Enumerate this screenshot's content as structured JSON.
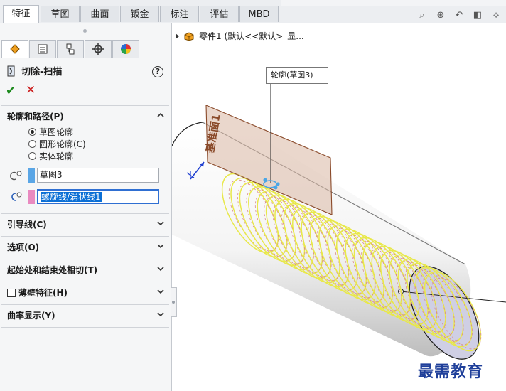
{
  "tabs": [
    "特征",
    "草图",
    "曲面",
    "钣金",
    "标注",
    "评估",
    "MBD"
  ],
  "panel": {
    "feature_title": "切除-扫描",
    "help": "?",
    "ok": "✔",
    "cancel": "✕",
    "sections": {
      "profile_path": "轮廓和路径(P)",
      "guide_curves": "引导线(C)",
      "options": "选项(O)",
      "start_end_tangency": "起始处和结束处相切(T)",
      "thin_feature": "薄壁特征(H)",
      "curvature_display": "曲率显示(Y)"
    },
    "radios": [
      {
        "label": "草图轮廓",
        "selected": true
      },
      {
        "label": "圆形轮廓(C)",
        "selected": false
      },
      {
        "label": "实体轮廓",
        "selected": false
      }
    ],
    "profile_selection": "草图3",
    "path_selection": "螺旋线/涡状线1",
    "profile_color": "#5aa6e6",
    "path_color": "#e98ac0"
  },
  "viewport": {
    "tree_label": "零件1 (默认<<默认>_显...",
    "callout": "轮廓(草图3)",
    "plane_label": "基准面1",
    "watermark": "最需教育"
  },
  "colors": {
    "accent": "#2f6fd2",
    "helix": "#e8e84a",
    "plane": "#8a4a2a"
  }
}
